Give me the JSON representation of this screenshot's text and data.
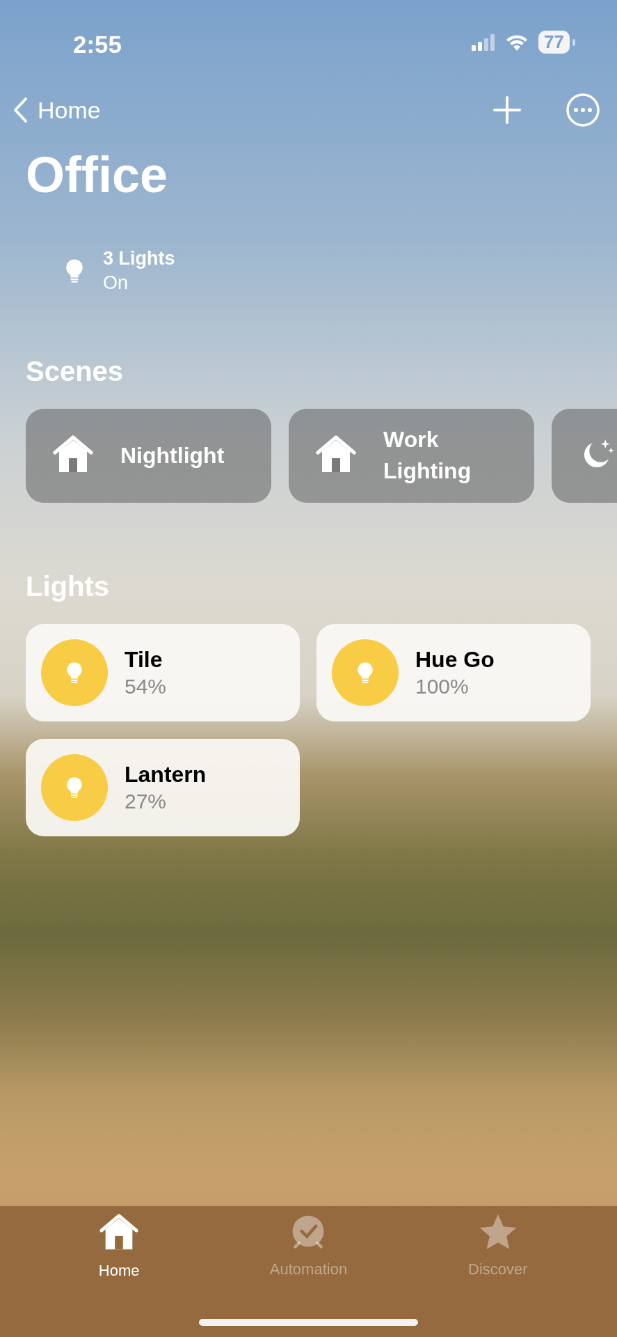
{
  "status_bar": {
    "time": "2:55",
    "battery": "77"
  },
  "nav": {
    "back_label": "Home"
  },
  "title": "Office",
  "summary": {
    "title": "3 Lights",
    "subtitle": "On"
  },
  "scenes": {
    "heading": "Scenes",
    "items": [
      {
        "label": "Nightlight",
        "kind": "home"
      },
      {
        "label": "Work Lighting",
        "kind": "home"
      },
      {
        "kind": "moon"
      }
    ]
  },
  "lights": {
    "heading": "Lights",
    "items": [
      {
        "name": "Tile",
        "value": "54%",
        "on": true
      },
      {
        "name": "Hue Go",
        "value": "100%",
        "on": true
      },
      {
        "name": "Lantern",
        "value": "27%",
        "on": true
      }
    ]
  },
  "tab_bar": {
    "items": [
      {
        "label": "Home",
        "kind": "home",
        "selected": true
      },
      {
        "label": "Automation",
        "kind": "automation",
        "selected": false
      },
      {
        "label": "Discover",
        "kind": "discover",
        "selected": false
      }
    ]
  }
}
